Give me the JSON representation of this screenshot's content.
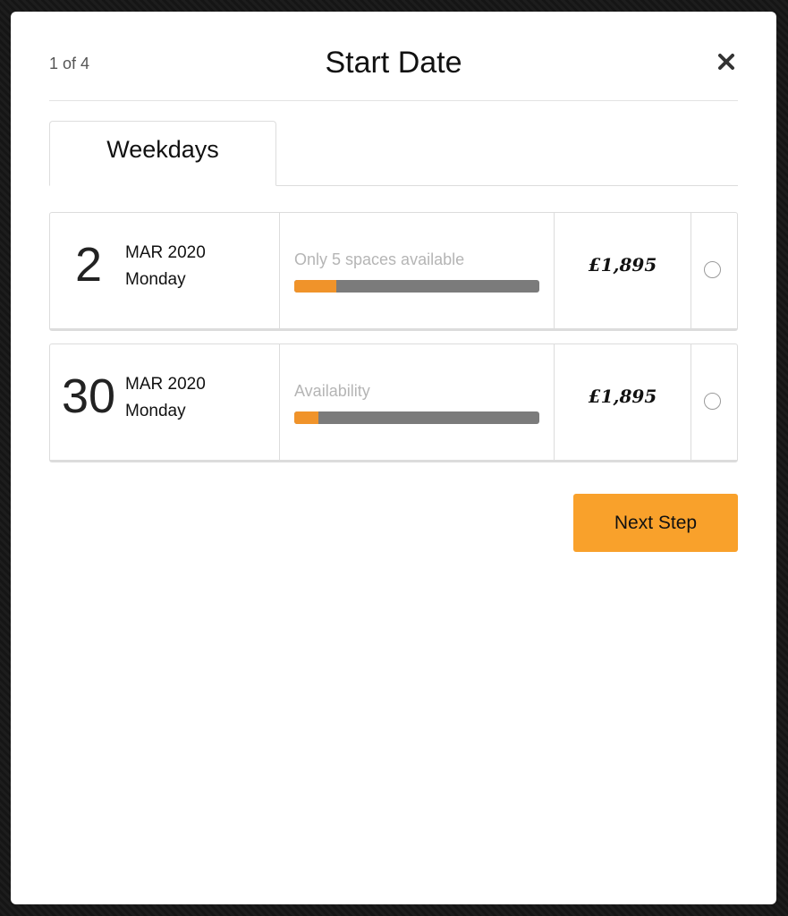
{
  "modal": {
    "step_counter": "1 of 4",
    "title": "Start Date",
    "close_icon": "close-icon"
  },
  "tabs": [
    {
      "label": "Weekdays",
      "active": true
    }
  ],
  "dates": [
    {
      "day": "2",
      "month_year": "MAR 2020",
      "weekday": "Monday",
      "availability_label": "Only 5 spaces available",
      "availability_fill_percent": 17,
      "price": "£1,895",
      "selected": false
    },
    {
      "day": "30",
      "month_year": "MAR 2020",
      "weekday": "Monday",
      "availability_label": "Availability",
      "availability_fill_percent": 10,
      "price": "£1,895",
      "selected": false
    }
  ],
  "actions": {
    "next_label": "Next Step"
  },
  "colors": {
    "accent": "#f9a12b",
    "bar_fill": "#f0932a",
    "bar_track": "#7b7b7b"
  }
}
